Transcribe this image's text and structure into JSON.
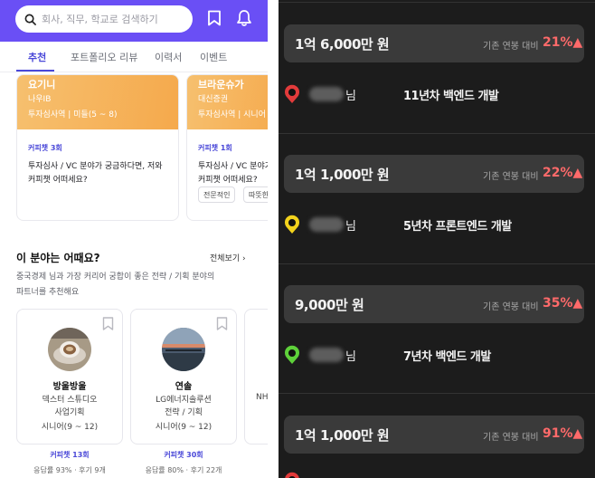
{
  "left": {
    "search": {
      "placeholder": "회사, 직무, 학교로 검색하기"
    },
    "tabs": [
      {
        "label": "추천",
        "active": true
      },
      {
        "label": "포트폴리오 리뷰",
        "active": false
      },
      {
        "label": "이력서",
        "active": false
      },
      {
        "label": "이벤트",
        "active": false
      }
    ],
    "mentor_cards": [
      {
        "name": "요기니",
        "company": "나우IB",
        "role": "투자심사역 | 미들(5 ~ 8)",
        "chat": "커피챗 3회",
        "question_line1": "투자심사 / VC 분야가 궁금하다면, 저와",
        "question_line2": "커피챗 어떠세요?",
        "chips": []
      },
      {
        "name": "브라운슈가",
        "company": "대신증권",
        "role": "투자심사역 | 시니어",
        "chat": "커피챗 1회",
        "question_line1": "투자심사 / VC 분야가 궁금",
        "question_line2": "커피챗 어떠세요?",
        "chips": [
          "전문적인",
          "따뜻한"
        ]
      }
    ],
    "section": {
      "title": "이 분야는 어때요?",
      "more": "전체보기",
      "desc_line1": "중국경제 님과 가장 커리어 궁합이 좋은 전략 / 기획 분야의",
      "desc_line2": "파트너를 추천해요"
    },
    "partners": [
      {
        "name": "방울방울",
        "company": "덱스터 스튜디오",
        "role": "사업기획",
        "level": "시니어(9 ~ 12)",
        "chat": "커피챗 13회",
        "stats": "응답률 93% · 후기 9개"
      },
      {
        "name": "연솔",
        "company": "LG에너지솔루션",
        "role": "전략 / 기획",
        "level": "시니어(9 ~ 12)",
        "chat": "커피챗 30회",
        "stats": "응답률 80% · 후기 22개"
      },
      {
        "name": "",
        "company": "NH",
        "role": "",
        "level": "",
        "chat": "",
        "stats": ""
      }
    ],
    "colors": {
      "brand": "#6a4ff5",
      "accent": "#4a48d8",
      "banner": "#f5a94c"
    }
  },
  "right": {
    "entries": [
      {
        "amount": "1억 6,000만 원",
        "compare_label": "기존 연봉 대비",
        "increase": "21%▲",
        "nim": "님",
        "job": "11년차 백엔드 개발",
        "icon_color": "#e23b3b"
      },
      {
        "amount": "1억 1,000만 원",
        "compare_label": "기존 연봉 대비",
        "increase": "22%▲",
        "nim": "님",
        "job": "5년차 프론트엔드 개발",
        "icon_color": "#f2d21c"
      },
      {
        "amount": "9,000만 원",
        "compare_label": "기존 연봉 대비",
        "increase": "35%▲",
        "nim": "님",
        "job": "7년차 백엔드 개발",
        "icon_color": "#5ed13a"
      },
      {
        "amount": "1억 1,000만 원",
        "compare_label": "기존 연봉 대비",
        "increase": "91%▲",
        "nim": "",
        "job": "",
        "icon_color": "#e23b3b"
      }
    ],
    "colors": {
      "background": "#1c1c1c",
      "box": "#3a3a3a",
      "increase": "#ff6a6a"
    }
  }
}
